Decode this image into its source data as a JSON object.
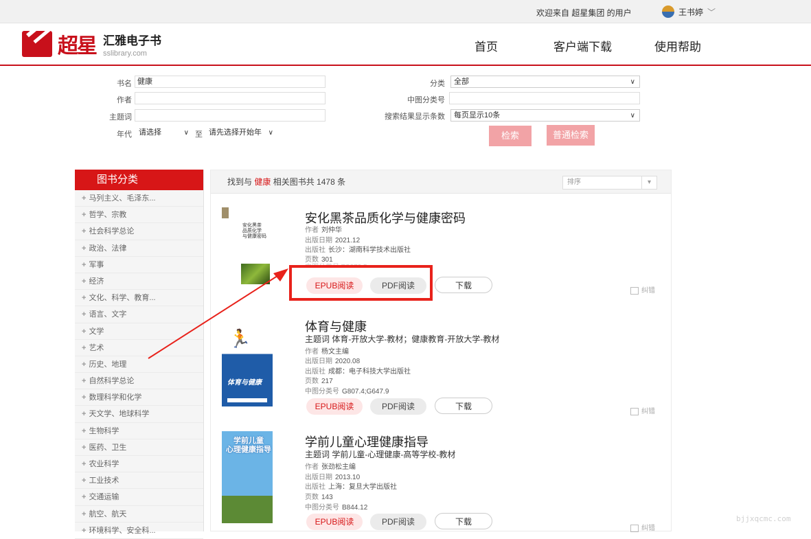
{
  "topbar": {
    "welcome": "欢迎来自 超星集团 的用户",
    "username": "王书婷",
    "dropdown": "﹀"
  },
  "header": {
    "logo_cn": "超星",
    "brand": "汇雅电子书",
    "domain": "sslibrary.com",
    "nav": [
      "首页",
      "客户端下载",
      "使用帮助"
    ]
  },
  "search_form": {
    "title_label": "书名",
    "title_value": "健康",
    "author_label": "作者",
    "subject_label": "主题词",
    "year_label": "年代",
    "year_from": "请选择",
    "year_to_label": "至",
    "year_to": "请先选择开始年",
    "category_label": "分类",
    "category_value": "全部",
    "clc_label": "中图分类号",
    "page_size_label": "搜索结果显示条数",
    "page_size_value": "每页显示10条",
    "search_button": "检索",
    "normal_search_button": "普通检索"
  },
  "sidebar": {
    "title": "图书分类",
    "items": [
      "马列主义、毛泽东...",
      "哲学、宗教",
      "社会科学总论",
      "政治、法律",
      "军事",
      "经济",
      "文化、科学、教育...",
      "语言、文字",
      "文学",
      "艺术",
      "历史、地理",
      "自然科学总论",
      "数理科学和化学",
      "天文学、地球科学",
      "生物科学",
      "医药、卫生",
      "农业科学",
      "工业技术",
      "交通运输",
      "航空、航天",
      "环境科学、安全科..."
    ]
  },
  "results": {
    "found_prefix": "找到与",
    "keyword": "健康",
    "found_suffix": "相关图书共 1478 条",
    "sort_placeholder": "排序",
    "books": [
      {
        "title": "安化黑茶品质化学与健康密码",
        "author": "刘仲华",
        "date": "2021.12",
        "publisher": "长沙：湖南科学技术出版社",
        "pages": "301",
        "clc_partial": "中图分类号 TS272.5"
      },
      {
        "title": "体育与健康",
        "subject": "体育-开放大学-教材；健康教育-开放大学-教材",
        "author": "杨文主编",
        "date": "2020.08",
        "publisher": "成都：电子科技大学出版社",
        "pages": "217",
        "clc": "G807.4;G647.9"
      },
      {
        "title": "学前儿童心理健康指导",
        "subject": "学前儿童-心理健康-高等学校-教材",
        "author": "张劲松主编",
        "date": "2013.10",
        "publisher": "上海：复旦大学出版社",
        "pages": "143",
        "clc": "B844.12"
      }
    ],
    "labels": {
      "subject": "主题词",
      "author": "作者",
      "date": "出版日期",
      "publisher": "出版社",
      "pages": "页数",
      "clc": "中图分类号",
      "epub": "EPUB阅读",
      "pdf": "PDF阅读",
      "download": "下载",
      "correct": "纠错"
    },
    "cover_texts": {
      "book1": "安化黑茶\n品质化学\n与健康密码",
      "book2": "体育与健康",
      "book3": "学前儿童\n心理健康指导"
    }
  },
  "watermark": "bjjxqcmc.com",
  "colors": {
    "brand_red": "#d71617",
    "annotation_red": "#e8221b"
  }
}
